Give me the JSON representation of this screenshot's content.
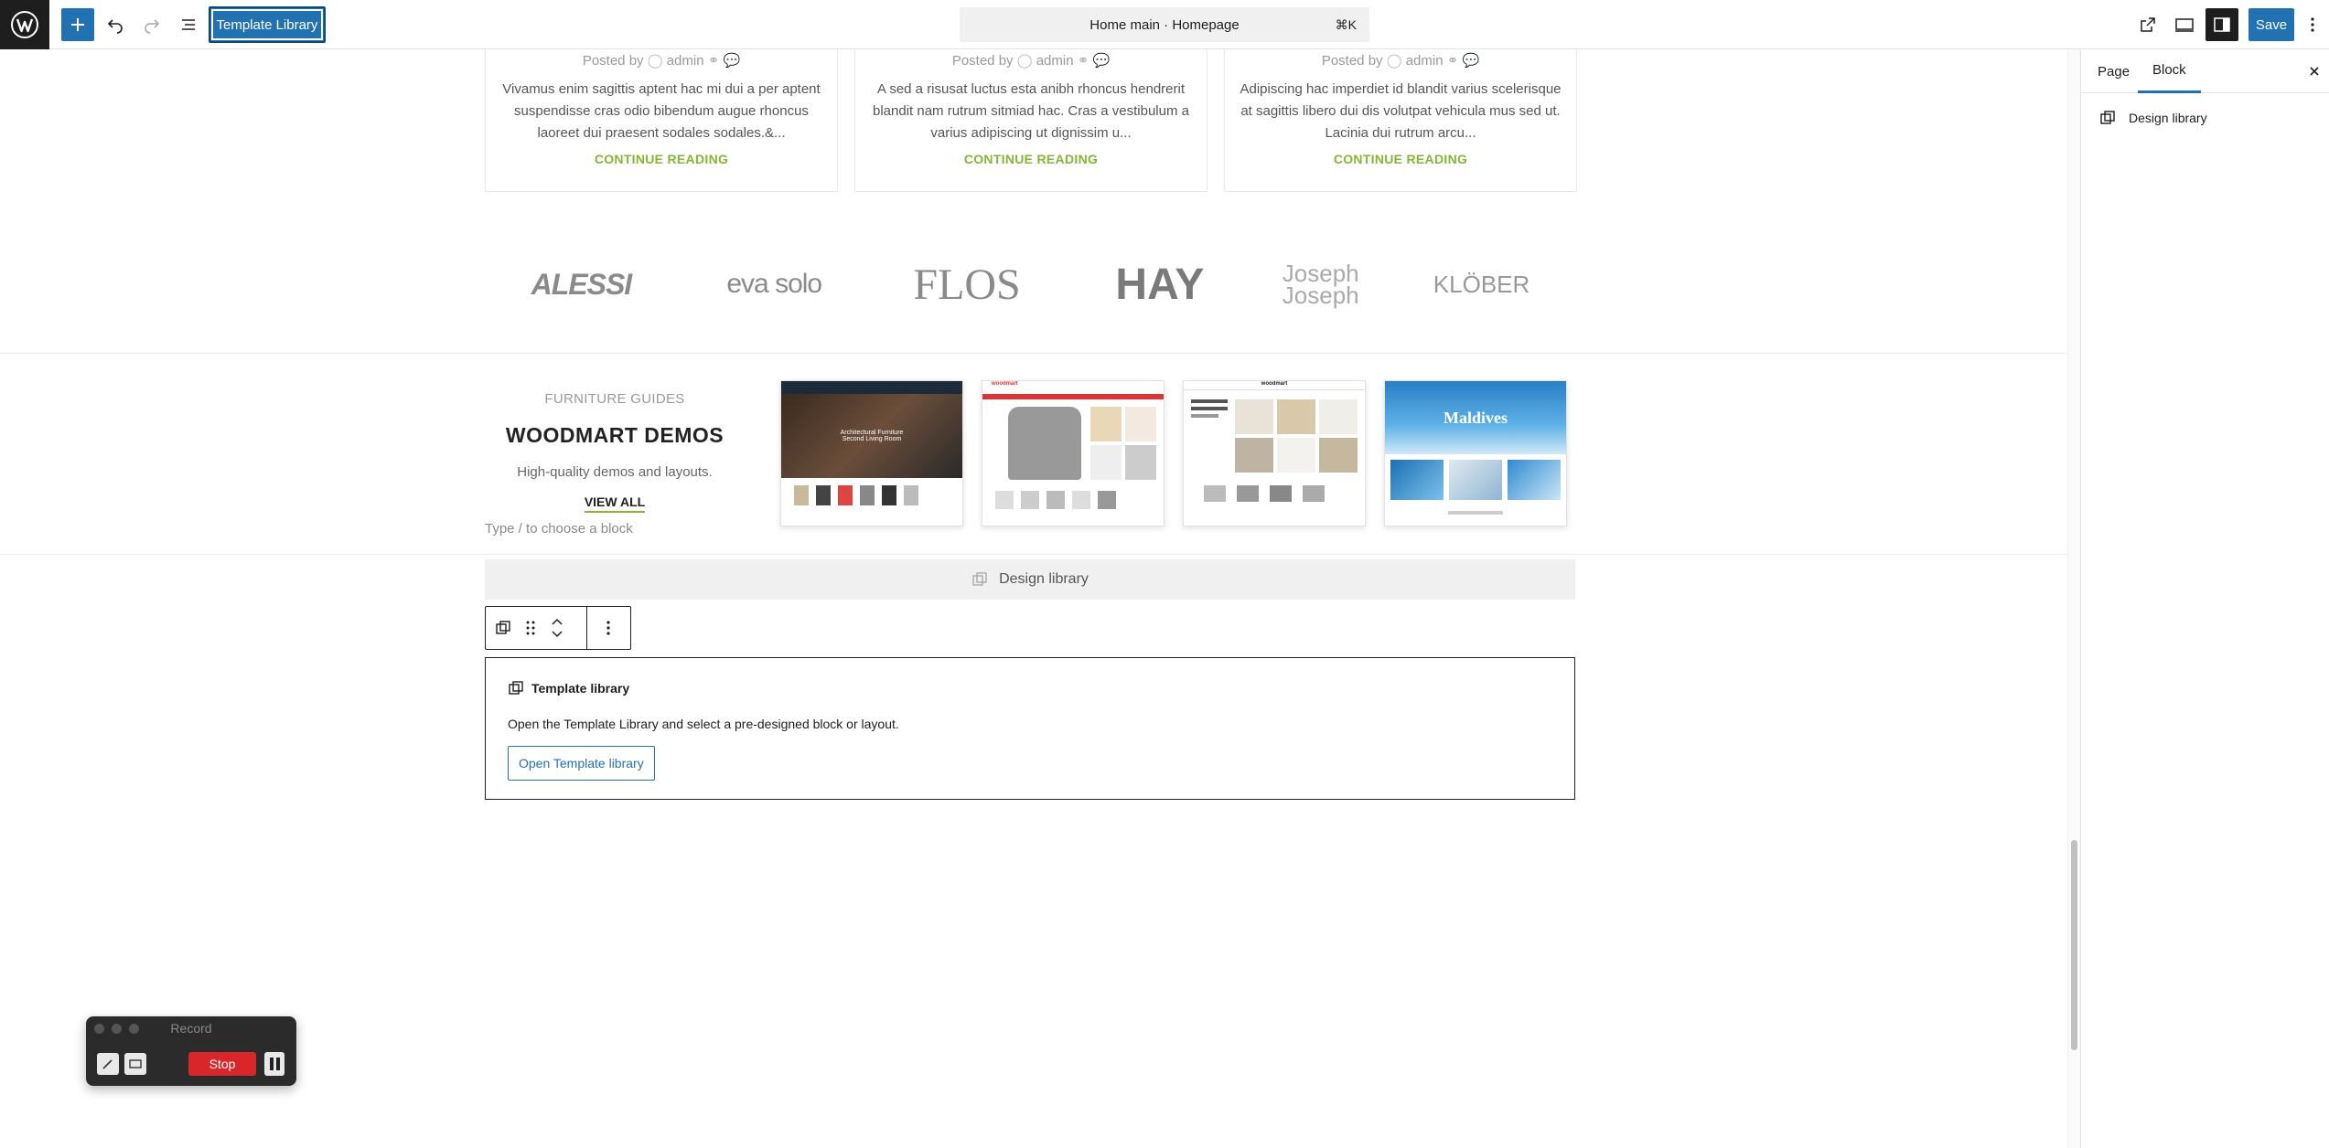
{
  "topbar": {
    "template_library_label": "Template Library",
    "command_bar_title": "Home main · Homepage",
    "command_bar_shortcut": "⌘K",
    "save_label": "Save"
  },
  "posts": [
    {
      "meta_prefix": "Posted by",
      "author": "admin",
      "excerpt": "Vivamus enim sagittis aptent hac mi dui a per aptent suspendisse cras odio bibendum augue rhoncus laoreet dui praesent sodales sodales.&...",
      "cta": "CONTINUE READING"
    },
    {
      "meta_prefix": "Posted by",
      "author": "admin",
      "excerpt": "A sed a risusat luctus esta anibh rhoncus hendrerit blandit nam rutrum sitmiad hac. Cras a vestibulum a varius adipiscing ut dignissim u...",
      "cta": "CONTINUE READING"
    },
    {
      "meta_prefix": "Posted by",
      "author": "admin",
      "excerpt": "Adipiscing hac imperdiet id blandit varius scelerisque at sagittis libero dui dis volutpat vehicula mus sed ut. Lacinia dui rutrum arcu...",
      "cta": "CONTINUE READING"
    }
  ],
  "brands": [
    "ALESSI",
    "eva solo",
    "FLOS",
    "HAY",
    "Joseph Joseph",
    "KLÖBER"
  ],
  "guides": {
    "subtitle": "FURNITURE GUIDES",
    "title": "WOODMART DEMOS",
    "description": "High-quality demos and layouts.",
    "link": "VIEW ALL"
  },
  "demo_thumbnails": [
    {
      "label": "woodmart",
      "headline": "Architectural Furniture Second Living Room"
    },
    {
      "label": "woodmart",
      "headline": ""
    },
    {
      "label": "woodmart",
      "headline": ""
    },
    {
      "label": "",
      "headline": "Maldives"
    }
  ],
  "block_placeholder": "Type / to choose a block",
  "design_library_bar": "Design library",
  "template_block": {
    "title": "Template library",
    "description": "Open the Template Library and select a pre-designed block or layout.",
    "button": "Open Template library"
  },
  "panel": {
    "tabs": [
      "Page",
      "Block"
    ],
    "active_tab": "Block",
    "block_name": "Design library"
  },
  "recorder": {
    "title": "Record",
    "stop_label": "Stop"
  },
  "colors": {
    "accent": "#2271b1",
    "brand_green": "#83b735",
    "stop_red": "#d9262b"
  }
}
